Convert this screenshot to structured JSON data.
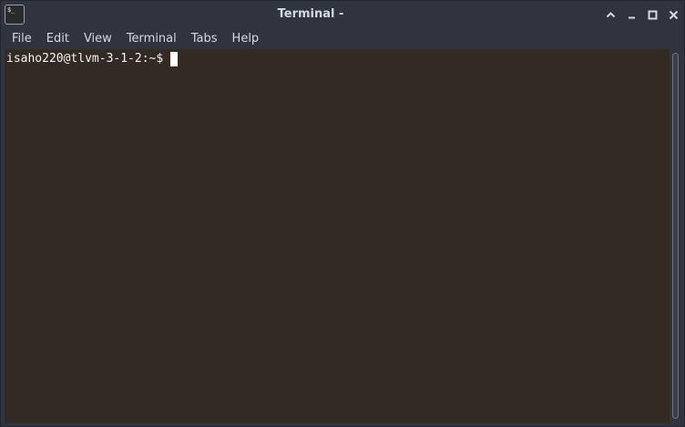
{
  "window": {
    "title": "Terminal -",
    "app_icon_glyph": "$_"
  },
  "menu": {
    "items": [
      {
        "label": "File"
      },
      {
        "label": "Edit"
      },
      {
        "label": "View"
      },
      {
        "label": "Terminal"
      },
      {
        "label": "Tabs"
      },
      {
        "label": "Help"
      }
    ]
  },
  "terminal": {
    "prompt": "isaho220@tlvm-3-1-2:~$"
  },
  "icons": {
    "app": "terminal-icon",
    "maximize": "chevron-up-icon",
    "minimize": "minimize-icon",
    "restore": "maximize-icon",
    "close": "close-icon"
  },
  "colors": {
    "titlebar_bg": "#2f343f",
    "text": "#d3dae3",
    "terminal_bg": "#342a24",
    "terminal_fg": "#f2f2f2",
    "cursor": "#ffffff"
  }
}
